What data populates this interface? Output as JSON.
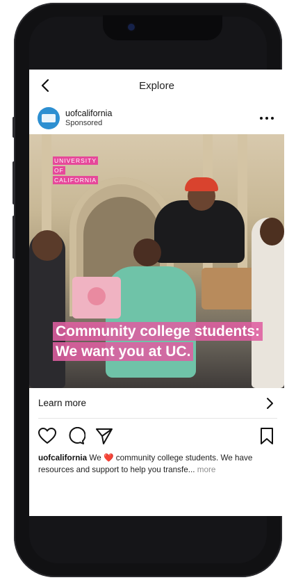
{
  "nav": {
    "title": "Explore"
  },
  "post": {
    "username": "uofcalifornia",
    "sponsored": "Sponsored",
    "logo_lines": [
      "UNIVERSITY",
      "OF",
      "CALIFORNIA"
    ],
    "headline_lines": [
      "Community college students:",
      "We want you at UC."
    ],
    "cta_label": "Learn more",
    "caption_user": "uofcalifornia",
    "caption_pre": " We ",
    "caption_emoji": "❤️",
    "caption_post": " community college students. We have resources and support to help you transfe...",
    "caption_more": "more"
  },
  "colors": {
    "accent_pink": "#e6489a",
    "avatar_blue": "#2d8fd1"
  },
  "icons": {
    "back": "chevron-left-icon",
    "options": "more-options-icon",
    "cta": "chevron-right-icon",
    "like": "heart-icon",
    "comment": "comment-icon",
    "share": "send-icon",
    "save": "bookmark-icon"
  }
}
